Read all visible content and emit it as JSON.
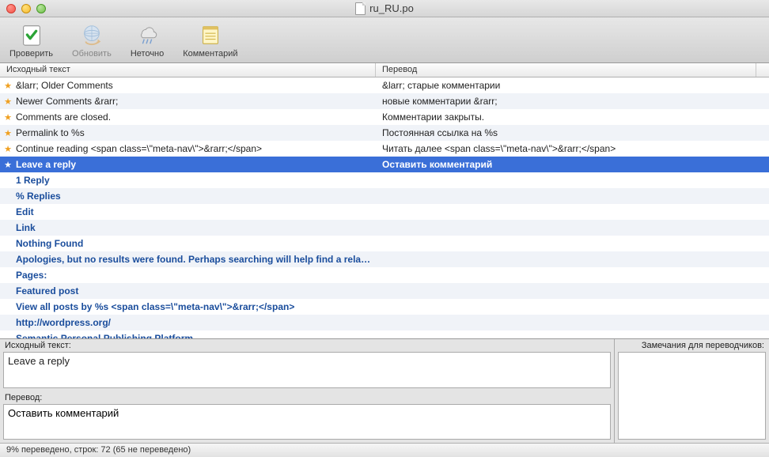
{
  "title": "ru_RU.po",
  "toolbar": {
    "check": "Проверить",
    "refresh": "Обновить",
    "fuzzy": "Неточно",
    "comment": "Комментарий"
  },
  "columns": {
    "source": "Исходный текст",
    "translation": "Перевод"
  },
  "rows": [
    {
      "star": true,
      "src": "&larr; Older Comments",
      "tr": "&larr; старые комментарии",
      "status": "translated"
    },
    {
      "star": true,
      "src": "Newer Comments &rarr;",
      "tr": "новые комментарии &rarr;",
      "status": "translated"
    },
    {
      "star": true,
      "src": "Comments are closed.",
      "tr": "Комментарии закрыты.",
      "status": "translated"
    },
    {
      "star": true,
      "src": "Permalink to %s",
      "tr": "Постоянная ссылка на %s",
      "status": "translated"
    },
    {
      "star": true,
      "src": "Continue reading <span class=\\\"meta-nav\\\">&rarr;</span>",
      "tr": "Читать далее <span class=\\\"meta-nav\\\">&rarr;</span>",
      "status": "translated"
    },
    {
      "star": true,
      "src": "Leave a reply",
      "tr": "Оставить комментарий",
      "status": "translated",
      "selected": true
    },
    {
      "star": false,
      "src": "1 Reply",
      "tr": "",
      "status": "untranslated"
    },
    {
      "star": false,
      "src": "% Replies",
      "tr": "",
      "status": "untranslated"
    },
    {
      "star": false,
      "src": "Edit",
      "tr": "",
      "status": "untranslated"
    },
    {
      "star": false,
      "src": "Link",
      "tr": "",
      "status": "untranslated"
    },
    {
      "star": false,
      "src": "Nothing Found",
      "tr": "",
      "status": "untranslated"
    },
    {
      "star": false,
      "src": "Apologies, but no results were found. Perhaps searching will help find a rela…",
      "tr": "",
      "status": "untranslated"
    },
    {
      "star": false,
      "src": "Pages:",
      "tr": "",
      "status": "untranslated"
    },
    {
      "star": false,
      "src": "Featured post",
      "tr": "",
      "status": "untranslated"
    },
    {
      "star": false,
      "src": "View all posts by %s <span class=\\\"meta-nav\\\">&rarr;</span>",
      "tr": "",
      "status": "untranslated"
    },
    {
      "star": false,
      "src": "http://wordpress.org/",
      "tr": "",
      "status": "untranslated"
    },
    {
      "star": false,
      "src": "Semantic Personal Publishing Platform",
      "tr": "",
      "status": "untranslated"
    }
  ],
  "panels": {
    "source_label": "Исходный текст:",
    "source_value": "Leave a reply",
    "translation_label": "Перевод:",
    "translation_value": "Оставить комментарий",
    "notes_label": "Замечания для переводчиков:",
    "notes_value": ""
  },
  "status": "9% переведено, строк: 72 (65 не переведено)"
}
